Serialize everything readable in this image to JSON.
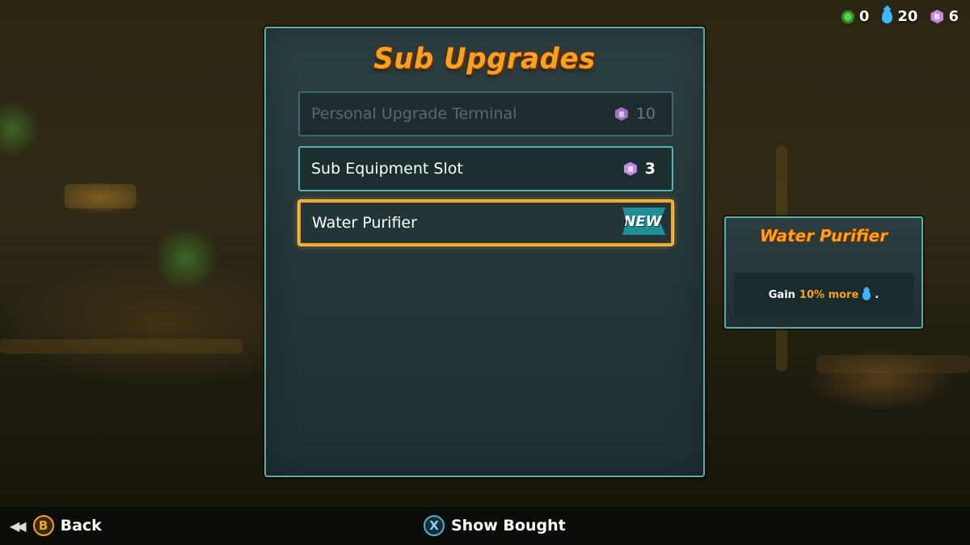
{
  "currencies": [
    {
      "icon": "green-orb-icon",
      "value": "0"
    },
    {
      "icon": "water-drop-icon",
      "value": "20"
    },
    {
      "icon": "purple-gem-icon",
      "value": "6"
    }
  ],
  "main_panel": {
    "title": "Sub Upgrades",
    "items": [
      {
        "label": "Personal Upgrade Terminal",
        "cost": "10",
        "state": "disabled"
      },
      {
        "label": "Sub Equipment Slot",
        "cost": "3",
        "state": "normal"
      },
      {
        "label": "Water Purifier",
        "badge": "NEW!",
        "state": "selected"
      }
    ]
  },
  "info_panel": {
    "title": "Water Purifier",
    "desc_prefix": "Gain",
    "desc_highlight": "10% more",
    "desc_suffix": "."
  },
  "bottom_bar": {
    "back_button_glyph": "B",
    "back_label": "Back",
    "show_bought_glyph": "X",
    "show_bought_label": "Show Bought"
  },
  "colors": {
    "accent_orange": "#f7a322",
    "panel_border": "#5fa9a9",
    "selected_border": "#f4a524"
  }
}
